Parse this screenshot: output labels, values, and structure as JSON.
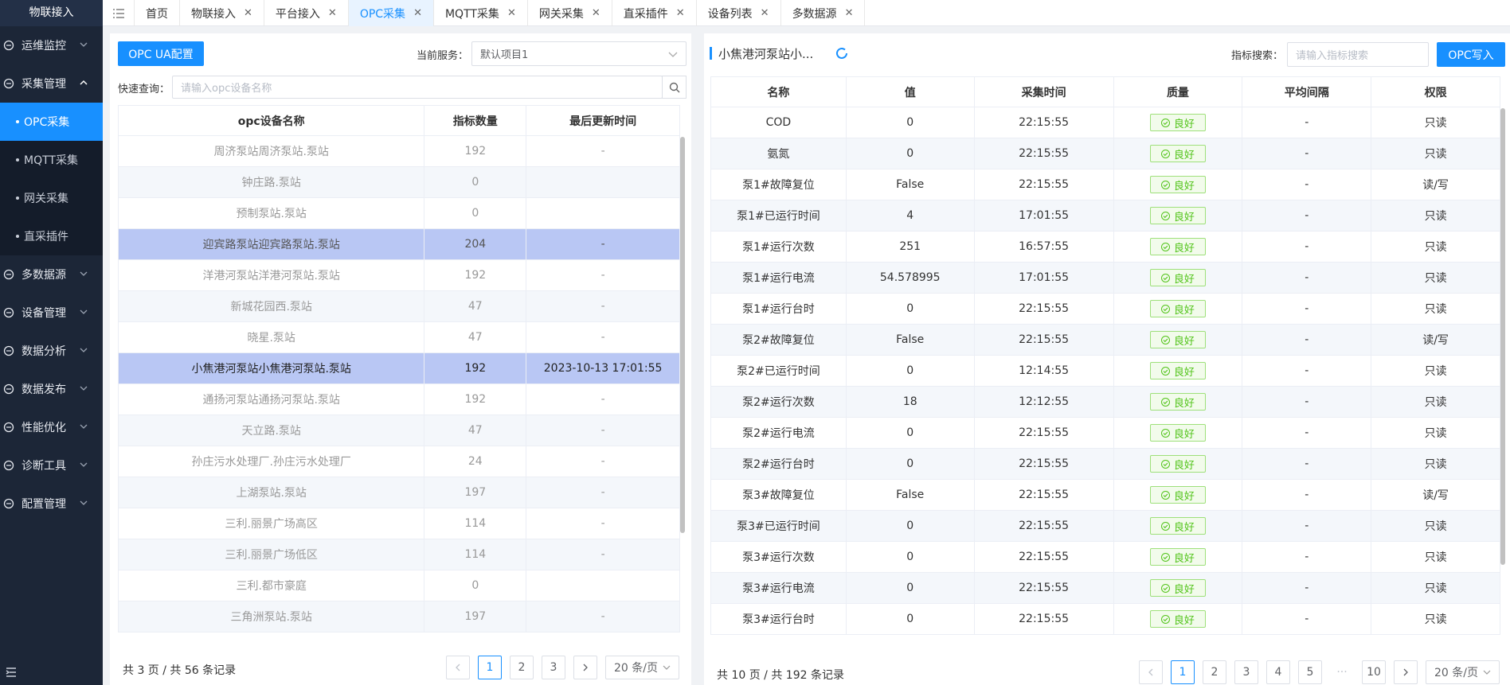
{
  "sidebar": {
    "title": "物联接入",
    "items": [
      {
        "label": "运维监控",
        "icon": "monitor-icon"
      },
      {
        "label": "采集管理",
        "icon": "collect-icon"
      },
      {
        "label": "多数据源",
        "icon": "database-icon"
      },
      {
        "label": "设备管理",
        "icon": "device-icon"
      },
      {
        "label": "数据分析",
        "icon": "analysis-icon"
      },
      {
        "label": "数据发布",
        "icon": "publish-icon"
      },
      {
        "label": "性能优化",
        "icon": "performance-icon"
      },
      {
        "label": "诊断工具",
        "icon": "toolbox-icon"
      },
      {
        "label": "配置管理",
        "icon": "gear-icon"
      }
    ],
    "sub_items": [
      "OPC采集",
      "MQTT采集",
      "网关采集",
      "直采插件"
    ]
  },
  "tabs": [
    "首页",
    "物联接入",
    "平台接入",
    "OPC采集",
    "MQTT采集",
    "网关采集",
    "直采插件",
    "设备列表",
    "多数据源"
  ],
  "left": {
    "config_button": "OPC UA配置",
    "service_label": "当前服务：",
    "service_value": "默认项目1",
    "quick_label": "快速查询：",
    "quick_placeholder": "请输入opc设备名称",
    "columns": [
      "opc设备名称",
      "指标数量",
      "最后更新时间"
    ],
    "rows": [
      [
        "周济泵站周济泵站.泵站",
        "192",
        "-"
      ],
      [
        "钟庄路.泵站",
        "0",
        ""
      ],
      [
        "预制泵站.泵站",
        "0",
        ""
      ],
      [
        "迎宾路泵站迎宾路泵站.泵站",
        "204",
        "-"
      ],
      [
        "洋港河泵站洋港河泵站.泵站",
        "192",
        "-"
      ],
      [
        "新城花园西.泵站",
        "47",
        "-"
      ],
      [
        "晓星.泵站",
        "47",
        "-"
      ],
      [
        "小焦港河泵站小焦港河泵站.泵站",
        "192",
        "2023-10-13 17:01:55"
      ],
      [
        "通扬河泵站通扬河泵站.泵站",
        "192",
        "-"
      ],
      [
        "天立路.泵站",
        "47",
        "-"
      ],
      [
        "孙庄污水处理厂.孙庄污水处理厂",
        "24",
        "-"
      ],
      [
        "上湖泵站.泵站",
        "197",
        "-"
      ],
      [
        "三利.丽景广场高区",
        "114",
        "-"
      ],
      [
        "三利.丽景广场低区",
        "114",
        "-"
      ],
      [
        "三利.都市豪庭",
        "0",
        ""
      ],
      [
        "三角洲泵站.泵站",
        "197",
        "-"
      ]
    ],
    "pager_text": "共 3 页 / 共 56 条记录",
    "pages": [
      "1",
      "2",
      "3"
    ],
    "page_size": "20 条/页"
  },
  "right": {
    "title": "小焦港河泵站小...",
    "search_label": "指标搜索：",
    "search_placeholder": "请输入指标搜索",
    "write_button": "OPC写入",
    "columns": [
      "名称",
      "值",
      "采集时间",
      "质量",
      "平均间隔",
      "权限"
    ],
    "quality_label": "良好",
    "rows": [
      [
        "COD",
        "0",
        "22:15:55",
        "-",
        "只读"
      ],
      [
        "氨氮",
        "0",
        "22:15:55",
        "-",
        "只读"
      ],
      [
        "泵1#故障复位",
        "False",
        "22:15:55",
        "-",
        "读/写"
      ],
      [
        "泵1#已运行时间",
        "4",
        "17:01:55",
        "-",
        "只读"
      ],
      [
        "泵1#运行次数",
        "251",
        "16:57:55",
        "-",
        "只读"
      ],
      [
        "泵1#运行电流",
        "54.578995",
        "17:01:55",
        "-",
        "只读"
      ],
      [
        "泵1#运行台时",
        "0",
        "22:15:55",
        "-",
        "只读"
      ],
      [
        "泵2#故障复位",
        "False",
        "22:15:55",
        "-",
        "读/写"
      ],
      [
        "泵2#已运行时间",
        "0",
        "12:14:55",
        "-",
        "只读"
      ],
      [
        "泵2#运行次数",
        "18",
        "12:12:55",
        "-",
        "只读"
      ],
      [
        "泵2#运行电流",
        "0",
        "22:15:55",
        "-",
        "只读"
      ],
      [
        "泵2#运行台时",
        "0",
        "22:15:55",
        "-",
        "只读"
      ],
      [
        "泵3#故障复位",
        "False",
        "22:15:55",
        "-",
        "读/写"
      ],
      [
        "泵3#已运行时间",
        "0",
        "22:15:55",
        "-",
        "只读"
      ],
      [
        "泵3#运行次数",
        "0",
        "22:15:55",
        "-",
        "只读"
      ],
      [
        "泵3#运行电流",
        "0",
        "22:15:55",
        "-",
        "只读"
      ],
      [
        "泵3#运行台时",
        "0",
        "22:15:55",
        "-",
        "只读"
      ]
    ],
    "pager_text": "共 10 页 / 共 192 条记录",
    "pages": [
      "1",
      "2",
      "3",
      "4",
      "5",
      "···",
      "10"
    ],
    "page_size": "20 条/页"
  },
  "colors": {
    "primary": "#1890ff",
    "sidebar": "#1c2637",
    "selected_row": "#b9c7f4",
    "good": "#52c41a"
  }
}
